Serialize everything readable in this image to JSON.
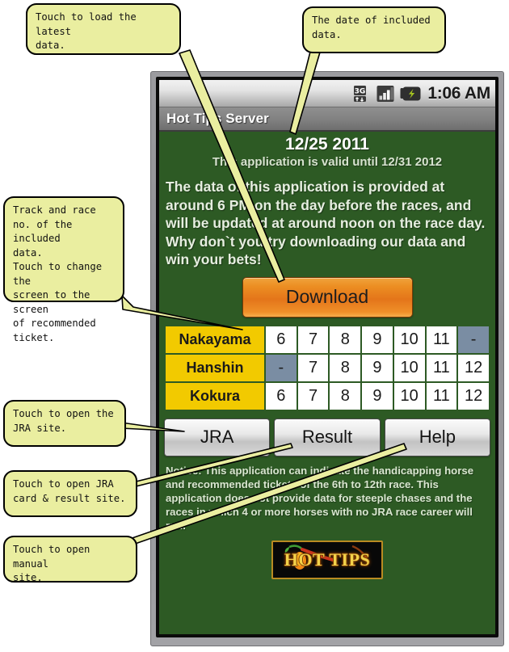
{
  "device": {
    "status_bar": {
      "network_icon": "3g-data-icon",
      "network_label": "3G",
      "signal_icon": "signal-bars-icon",
      "battery_icon": "battery-charging-icon",
      "clock": "1:06 AM"
    },
    "title_bar": {
      "app_title": "Hot Tips Server"
    }
  },
  "app": {
    "data_date": "12/25 2011",
    "validity_note": "This application is valid until 12/31 2012",
    "intro_text": "The data of this application is provided at around 6 PM on the day before the races, and will be updated at around noon on the race day. Why don`t you try downloading our data and win your bets!",
    "download_label": "Download",
    "notice_text": "Notice: This application can indicate the handicapping horse and recommended tickets of the 6th to 12th race. This application does not provide data for steeple chases and the races in which 4 or more horses with no JRA race career will run.",
    "logo_label": "HOT TIPS",
    "nav_buttons": [
      {
        "label": "JRA",
        "name": "jra-button"
      },
      {
        "label": "Result",
        "name": "result-button"
      },
      {
        "label": "Help",
        "name": "help-button"
      }
    ],
    "race_table": {
      "rows": [
        {
          "track": "Nakayama",
          "races": [
            "6",
            "7",
            "8",
            "9",
            "10",
            "11",
            "-"
          ],
          "disabled": [
            false,
            false,
            false,
            false,
            false,
            false,
            true
          ]
        },
        {
          "track": "Hanshin",
          "races": [
            "-",
            "7",
            "8",
            "9",
            "10",
            "11",
            "12"
          ],
          "disabled": [
            true,
            false,
            false,
            false,
            false,
            false,
            false
          ]
        },
        {
          "track": "Kokura",
          "races": [
            "6",
            "7",
            "8",
            "9",
            "10",
            "11",
            "12"
          ],
          "disabled": [
            false,
            false,
            false,
            false,
            false,
            false,
            false
          ]
        }
      ]
    }
  },
  "annotations": [
    {
      "id": "callout-download",
      "text": "Touch to load the latest\ndata."
    },
    {
      "id": "callout-date",
      "text": "The date of included\ndata."
    },
    {
      "id": "callout-table",
      "text": "Track and race\nno. of the included\ndata.\nTouch to change the\nscreen to the screen\nof recommended\nticket."
    },
    {
      "id": "callout-jra",
      "text": "Touch to open the\nJRA site."
    },
    {
      "id": "callout-result",
      "text": "Touch to open JRA\ncard & result site."
    },
    {
      "id": "callout-help",
      "text": "Touch to open manual\nsite."
    }
  ],
  "colors": {
    "screen_green": "#2d5a24",
    "accent_orange": "#e4751a",
    "track_gold": "#f2ca00",
    "disabled_slate": "#7a8da3",
    "callout_yellow": "#eaeea0"
  }
}
